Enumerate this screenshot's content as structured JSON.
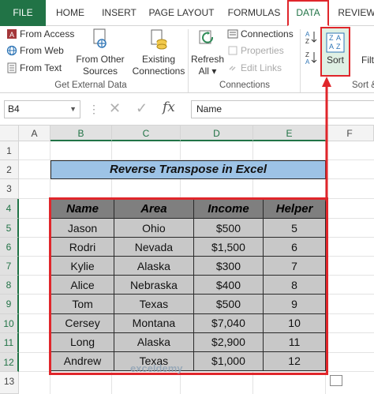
{
  "tabs": [
    {
      "label": "FILE"
    },
    {
      "label": "HOME"
    },
    {
      "label": "INSERT"
    },
    {
      "label": "PAGE LAYOUT"
    },
    {
      "label": "FORMULAS"
    },
    {
      "label": "DATA"
    },
    {
      "label": "REVIEW"
    }
  ],
  "ribbon": {
    "get_external": {
      "from_access": "From Access",
      "from_web": "From Web",
      "from_text": "From Text",
      "from_other_1": "From Other",
      "from_other_2": "Sources",
      "existing_1": "Existing",
      "existing_2": "Connections",
      "group_label": "Get External Data"
    },
    "connections": {
      "refresh_1": "Refresh",
      "refresh_2": "All",
      "connections": "Connections",
      "properties": "Properties",
      "edit_links": "Edit Links",
      "group_label": "Connections"
    },
    "sort": {
      "sort_label": "Sort",
      "filter_partial": "Filt",
      "group_partial": "Sort &"
    }
  },
  "formula_bar": {
    "name_box": "B4",
    "fx": "fx",
    "content": "Name"
  },
  "columns": [
    "A",
    "B",
    "C",
    "D",
    "E",
    "F"
  ],
  "rows": [
    "1",
    "2",
    "3",
    "4",
    "5",
    "6",
    "7",
    "8",
    "9",
    "10",
    "11",
    "12",
    "13"
  ],
  "sheet": {
    "title": "Reverse Transpose in Excel",
    "headers": [
      "Name",
      "Area",
      "Income",
      "Helper"
    ],
    "data": [
      [
        "Jason",
        "Ohio",
        "$500",
        "5"
      ],
      [
        "Rodri",
        "Nevada",
        "$1,500",
        "6"
      ],
      [
        "Kylie",
        "Alaska",
        "$300",
        "7"
      ],
      [
        "Alice",
        "Nebraska",
        "$400",
        "8"
      ],
      [
        "Tom",
        "Texas",
        "$500",
        "9"
      ],
      [
        "Cersey",
        "Montana",
        "$7,040",
        "10"
      ],
      [
        "Long",
        "Alaska",
        "$2,900",
        "11"
      ],
      [
        "Andrew",
        "Texas",
        "$1,000",
        "12"
      ]
    ]
  },
  "watermark": "exceldemy",
  "colors": {
    "excel_green": "#217346",
    "highlight_red": "#e0262b",
    "title_fill": "#9dc3e6",
    "header_fill": "#7f7f7f",
    "cell_fill": "#c8c8c8"
  }
}
